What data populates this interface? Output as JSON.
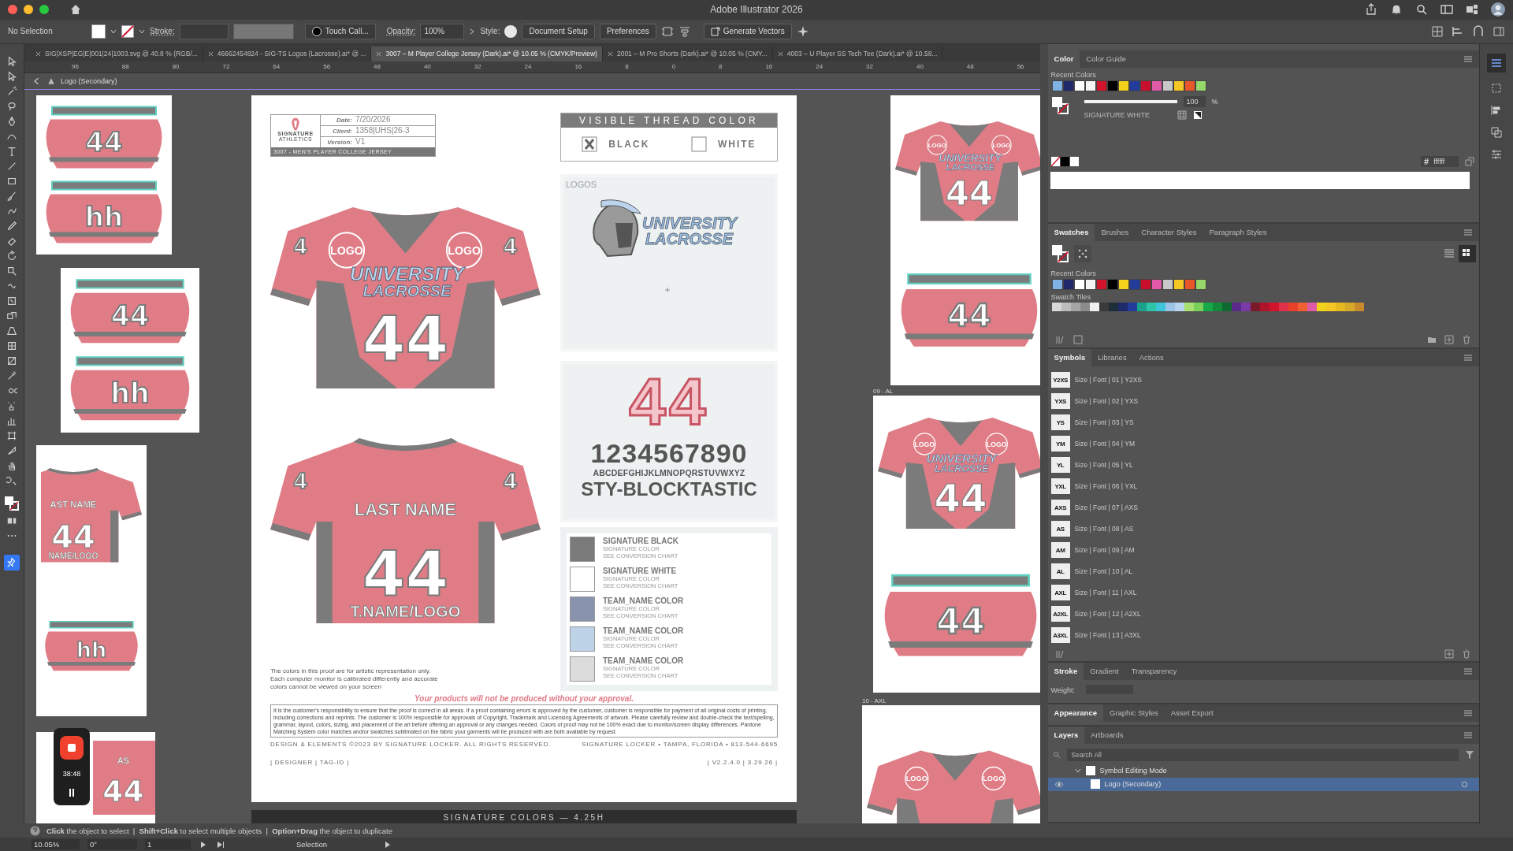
{
  "title_bar": {
    "title": "Adobe Illustrator 2026"
  },
  "control_bar": {
    "selection": "No Selection",
    "stroke_label": "Stroke:",
    "brush": "Touch Call...",
    "opacity_label": "Opacity:",
    "opacity": "100%",
    "style_label": "Style:",
    "buttons": [
      "Document Setup",
      "Preferences"
    ],
    "generate": "Generate Vectors"
  },
  "document_tabs": [
    {
      "label": "SIG|XSP|EG|E|001|24|1003.svg @ 40.8 % (RGB/...",
      "selected": false
    },
    {
      "label": "46662454824 - SIG-TS Logos (Lacrosse).ai* @ ...",
      "selected": false
    },
    {
      "label": "3007 – M Player College Jersey (Dark).ai* @ 10.05 % (CMYK/Preview)",
      "selected": true
    },
    {
      "label": "2001 – M Pro Shorts (Dark).ai* @ 10.05 % (CMY...",
      "selected": false
    },
    {
      "label": "4003 – U Player SS Tech Tee (Dark).ai* @ 10.58...",
      "selected": false
    }
  ],
  "ruler": [
    "96",
    "88",
    "80",
    "72",
    "64",
    "56",
    "48",
    "40",
    "32",
    "24",
    "16",
    "8",
    "0",
    "8",
    "16",
    "24",
    "32",
    "40",
    "48",
    "56"
  ],
  "breadcrumb": "Logo (Secondary)",
  "artboards": [
    {
      "pieces": [
        {
          "kind": "panel",
          "texts": [
            {
              "kind": "panel-number",
              "text": "44"
            }
          ]
        },
        {
          "kind": "panel",
          "texts": [
            {
              "kind": "panel-number",
              "text": "hh"
            }
          ]
        }
      ]
    },
    {
      "pieces": [
        {
          "kind": "panel",
          "texts": [
            {
              "kind": "panel-number",
              "text": "44"
            }
          ]
        },
        {
          "kind": "panel",
          "texts": [
            {
              "kind": "panel-number",
              "text": "hh"
            }
          ]
        }
      ]
    },
    {
      "pieces": [
        {
          "kind": "jersey-back-cropped",
          "texts": [
            {
              "kind": "name",
              "text": "AST NAME"
            },
            {
              "kind": "number",
              "text": "44"
            },
            {
              "kind": "team",
              "text": "NAME/LOGO"
            }
          ]
        },
        {
          "kind": "panel",
          "texts": [
            {
              "kind": "panel-number",
              "text": "hh"
            }
          ]
        }
      ]
    },
    {
      "pieces": [
        {
          "kind": "jersey-back-top",
          "texts": [
            {
              "kind": "name",
              "text": "AS"
            },
            {
              "kind": "number",
              "text": "44"
            }
          ]
        }
      ]
    },
    {
      "pieces": [
        {
          "kind": "jersey-front",
          "texts": [
            {
              "kind": "logo-left",
              "text": "LOGO"
            },
            {
              "kind": "logo-right",
              "text": "LOGO"
            },
            {
              "kind": "wordmark-top",
              "text": "UNIVERSITY"
            },
            {
              "kind": "wordmark-bottom",
              "text": "LACROSSE"
            },
            {
              "kind": "number",
              "text": "44"
            }
          ]
        },
        {
          "kind": "panel",
          "texts": [
            {
              "kind": "panel-number",
              "text": "44"
            }
          ]
        }
      ]
    },
    {
      "label": "09 - AL",
      "pieces": [
        {
          "kind": "jersey-front",
          "texts": [
            {
              "kind": "logo-left",
              "text": "LOGO"
            },
            {
              "kind": "logo-right",
              "text": "LOGO"
            },
            {
              "kind": "wordmark-top",
              "text": "UNIVERSITY"
            },
            {
              "kind": "wordmark-bottom",
              "text": "LACROSSE"
            },
            {
              "kind": "number",
              "text": "44"
            }
          ]
        },
        {
          "kind": "panel",
          "texts": [
            {
              "kind": "panel-number",
              "text": "44"
            }
          ]
        }
      ]
    },
    {
      "label": "10 - AXL",
      "pieces": [
        {
          "kind": "jersey-top",
          "texts": [
            {
              "kind": "logo-left",
              "text": "LOGO"
            },
            {
              "kind": "logo-right",
              "text": "LOGO"
            }
          ]
        }
      ]
    }
  ],
  "proof": {
    "brand": [
      "SIGNATURE",
      "ATHLETICS"
    ],
    "info": [
      {
        "label": "Date:",
        "value": "7/20/2026"
      },
      {
        "label": "Client:",
        "value": "1358|UHS|26-3"
      },
      {
        "label": "Version:",
        "value": "V1"
      }
    ],
    "product": "3007 - MEN'S PLAYER COLLEGE JERSEY",
    "thread_title": "VISIBLE THREAD COLOR",
    "thread_options": [
      {
        "label": "BLACK",
        "checked": true
      },
      {
        "label": "WHITE",
        "checked": false
      }
    ],
    "front_jersey": {
      "kind": "jersey-front",
      "texts": [
        {
          "kind": "sleeve-left",
          "text": "4"
        },
        {
          "kind": "sleeve-right",
          "text": "4"
        },
        {
          "kind": "logo-left",
          "text": "LOGO"
        },
        {
          "kind": "logo-right",
          "text": "LOGO"
        },
        {
          "kind": "wordmark-top",
          "text": "UNIVERSITY"
        },
        {
          "kind": "wordmark-bottom",
          "text": "LACROSSE"
        },
        {
          "kind": "number",
          "text": "44"
        }
      ]
    },
    "back_jersey": {
      "kind": "jersey-back",
      "texts": [
        {
          "kind": "sleeve-left",
          "text": "4"
        },
        {
          "kind": "sleeve-right",
          "text": "4"
        },
        {
          "kind": "name",
          "text": "LAST NAME"
        },
        {
          "kind": "number",
          "text": "44"
        },
        {
          "kind": "team",
          "text": "T.NAME/LOGO"
        }
      ]
    },
    "logos_label": "LOGOS",
    "logo_wordmark": [
      "UNIVERSITY",
      "LACROSSE"
    ],
    "font_samples": {
      "number": "44",
      "digits": "1234567890",
      "alphabet": "ABCDEFGHIJKLMNOPQRSTUVWXYZ",
      "font_name": "STY-BLOCKTASTIC"
    },
    "legend": [
      {
        "name": "SIGNATURE BLACK",
        "line1": "SIGNATURE COLOR",
        "line2": "SEE CONVERSION CHART",
        "color": "#7a7a7a"
      },
      {
        "name": "SIGNATURE WHITE",
        "line1": "SIGNATURE COLOR",
        "line2": "SEE CONVERSION CHART",
        "color": "#ffffff"
      },
      {
        "name": "TEAM_NAME COLOR",
        "line1": "SIGNATURE COLOR",
        "line2": "SEE CONVERSION CHART",
        "color": "#8a93ad"
      },
      {
        "name": "TEAM_NAME COLOR",
        "line1": "SIGNATURE COLOR",
        "line2": "SEE CONVERSION CHART",
        "color": "#bed2e8"
      },
      {
        "name": "TEAM_NAME COLOR",
        "line1": "SIGNATURE COLOR",
        "line2": "SEE CONVERSION CHART",
        "color": "#dcdcdc"
      }
    ],
    "disclaimer": "The colors in this proof are for artistic representation only. Each computer monitor is calibrated differently and accurate colors cannot be viewed on your screen",
    "approval": "Your products will not be produced without your approval.",
    "legal": "It is the customer's responsibility to ensure that the proof is correct in all areas. If a proof containing errors is approved by the customer, customer is responsible for payment of all original costs of printing, including corrections and reprints. The customer is 100% responsible for approvals of Copyright, Trademark and Licensing Agreements of artwork. Please carefully review and double-check the text/spelling, grammar, layout, colors, sizing, and placement of the art before offering an approval or any changes needed.  Colors of proof may not be 100% exact due to monitor/screen display differences. Pantone Matching System color matches and/or swatches sublimated on the fabric your garments will be produced with are both available by request.",
    "copyright": "DESIGN & ELEMENTS ©2023 BY SIGNATURE LOCKER. ALL RIGHTS RESERVED.",
    "address": "SIGNATURE LOCKER • TAMPA, FLORIDA • 813-544-6695",
    "designer": "| DESIGNER | TAG-ID |",
    "version": "| V2.2.4.0 | 3.29.26 |"
  },
  "colors_bar": "SIGNATURE COLORS — 4.25H",
  "recorder": {
    "time": "38:48"
  },
  "color_panel": {
    "tabs": [
      {
        "label": "Color",
        "selected": true
      },
      {
        "label": "Color Guide",
        "selected": false
      }
    ],
    "recent_label": "Recent Colors",
    "recent_colors": [
      {
        "color": "#7fb2e5"
      },
      {
        "color": "#1f2a6b"
      },
      {
        "color": "#ffffff"
      },
      {
        "color": "#f4f4f4"
      },
      {
        "color": "#d0142c"
      },
      {
        "color": "#000000"
      },
      {
        "color": "#f2d21b"
      },
      {
        "color": "#233c9c"
      },
      {
        "color": "#c8102e"
      },
      {
        "color": "#e05aa8"
      },
      {
        "color": "#c8c8c8"
      },
      {
        "color": "#f6c624"
      },
      {
        "color": "#e8572a"
      },
      {
        "color": "#98d86a"
      }
    ],
    "tint": {
      "level": 1,
      "value": "100",
      "unit": "%"
    },
    "swatch_name": "SIGNATURE WHITE",
    "hex_label": "#",
    "hex": "ffffff"
  },
  "swatches_panel": {
    "tabs": [
      {
        "label": "Swatches",
        "selected": true
      },
      {
        "label": "Brushes",
        "selected": false
      },
      {
        "label": "Character Styles",
        "selected": false
      },
      {
        "label": "Paragraph Styles",
        "selected": false
      }
    ],
    "recent_label": "Recent Colors",
    "recent_colors": [
      {
        "color": "#7fb2e5"
      },
      {
        "color": "#1f2a6b"
      },
      {
        "color": "#ffffff"
      },
      {
        "color": "#f4f4f4"
      },
      {
        "color": "#d0142c"
      },
      {
        "color": "#000000"
      },
      {
        "color": "#f2d21b"
      },
      {
        "color": "#233c9c"
      },
      {
        "color": "#c8102e"
      },
      {
        "color": "#e05aa8"
      },
      {
        "color": "#c8c8c8"
      },
      {
        "color": "#f6c624"
      },
      {
        "color": "#e8572a"
      },
      {
        "color": "#98d86a"
      }
    ],
    "tiles_label": "Swatch Tiles",
    "tiles": [
      {
        "color": "#d8d8d8"
      },
      {
        "color": "#bdbdbd"
      },
      {
        "color": "#a5a5a5"
      },
      {
        "color": "#8c8c8c"
      },
      {
        "color": "#f0f0f0"
      },
      {
        "color": "#3a3a3a"
      },
      {
        "color": "#1d2d3a"
      },
      {
        "color": "#1f2a6b"
      },
      {
        "color": "#233c9c"
      },
      {
        "color": "#1aa28c"
      },
      {
        "color": "#2ec4a8"
      },
      {
        "color": "#3cc6d8"
      },
      {
        "color": "#9cc4e8"
      },
      {
        "color": "#b8d4f0"
      },
      {
        "color": "#a8e070"
      },
      {
        "color": "#78d058"
      },
      {
        "color": "#18a848"
      },
      {
        "color": "#148a3c"
      },
      {
        "color": "#0e6a30"
      },
      {
        "color": "#5a2a8a"
      },
      {
        "color": "#7a3aa8"
      },
      {
        "color": "#7a1a2a"
      },
      {
        "color": "#b0142c"
      },
      {
        "color": "#d0142c"
      },
      {
        "color": "#e0304a"
      },
      {
        "color": "#e8402a"
      },
      {
        "color": "#f06030"
      },
      {
        "color": "#e05aa8"
      },
      {
        "color": "#f2d21b"
      },
      {
        "color": "#f6c624"
      },
      {
        "color": "#e8b820"
      },
      {
        "color": "#d8a828"
      },
      {
        "color": "#c88a2a"
      }
    ]
  },
  "symbols_panel": {
    "tabs": [
      {
        "label": "Symbols",
        "selected": true
      },
      {
        "label": "Libraries",
        "selected": false
      },
      {
        "label": "Actions",
        "selected": false
      }
    ],
    "symbols": [
      {
        "badge": "Y2XS",
        "name": "Size | Font | 01 | Y2XS"
      },
      {
        "badge": "YXS",
        "name": "Size | Font | 02 | YXS"
      },
      {
        "badge": "YS",
        "name": "Size | Font | 03 | YS"
      },
      {
        "badge": "YM",
        "name": "Size | Font | 04 | YM"
      },
      {
        "badge": "YL",
        "name": "Size | Font | 05 | YL"
      },
      {
        "badge": "YXL",
        "name": "Size | Font | 06 | YXL"
      },
      {
        "badge": "AXS",
        "name": "Size | Font | 07 | AXS"
      },
      {
        "badge": "AS",
        "name": "Size | Font | 08 | AS"
      },
      {
        "badge": "AM",
        "name": "Size | Font | 09 | AM"
      },
      {
        "badge": "AL",
        "name": "Size | Font | 10 | AL"
      },
      {
        "badge": "AXL",
        "name": "Size | Font | 11 | AXL"
      },
      {
        "badge": "A2XL",
        "name": "Size | Font | 12 | A2XL"
      },
      {
        "badge": "A3XL",
        "name": "Size | Font | 13 | A3XL"
      }
    ]
  },
  "stroke_panel": {
    "tabs": [
      {
        "label": "Stroke",
        "selected": true
      },
      {
        "label": "Gradient",
        "selected": false
      },
      {
        "label": "Transparency",
        "selected": false
      }
    ],
    "weight_label": "Weight:"
  },
  "appearance_panel": {
    "tabs": [
      {
        "label": "Appearance",
        "selected": true
      },
      {
        "label": "Graphic Styles",
        "selected": false
      },
      {
        "label": "Asset Export",
        "selected": false
      }
    ]
  },
  "layers_panel": {
    "tabs": [
      {
        "label": "Layers",
        "selected": true
      },
      {
        "label": "Artboards",
        "selected": false
      }
    ],
    "search_placeholder": "Search All",
    "layers": [
      {
        "name": "Symbol Editing Mode",
        "expanded": true,
        "selected": false,
        "visible": false,
        "children": [
          {
            "name": "Logo (Secondary)",
            "selected": true,
            "visible": true
          }
        ]
      }
    ]
  },
  "status": {
    "hint": "**Click** the object to select  |  **Shift+Click** to select multiple objects  |  **Option+Drag** the object to duplicate",
    "zoom": "10.05%",
    "rotation": "0°",
    "artboard": "1",
    "tool": "Selection"
  }
}
